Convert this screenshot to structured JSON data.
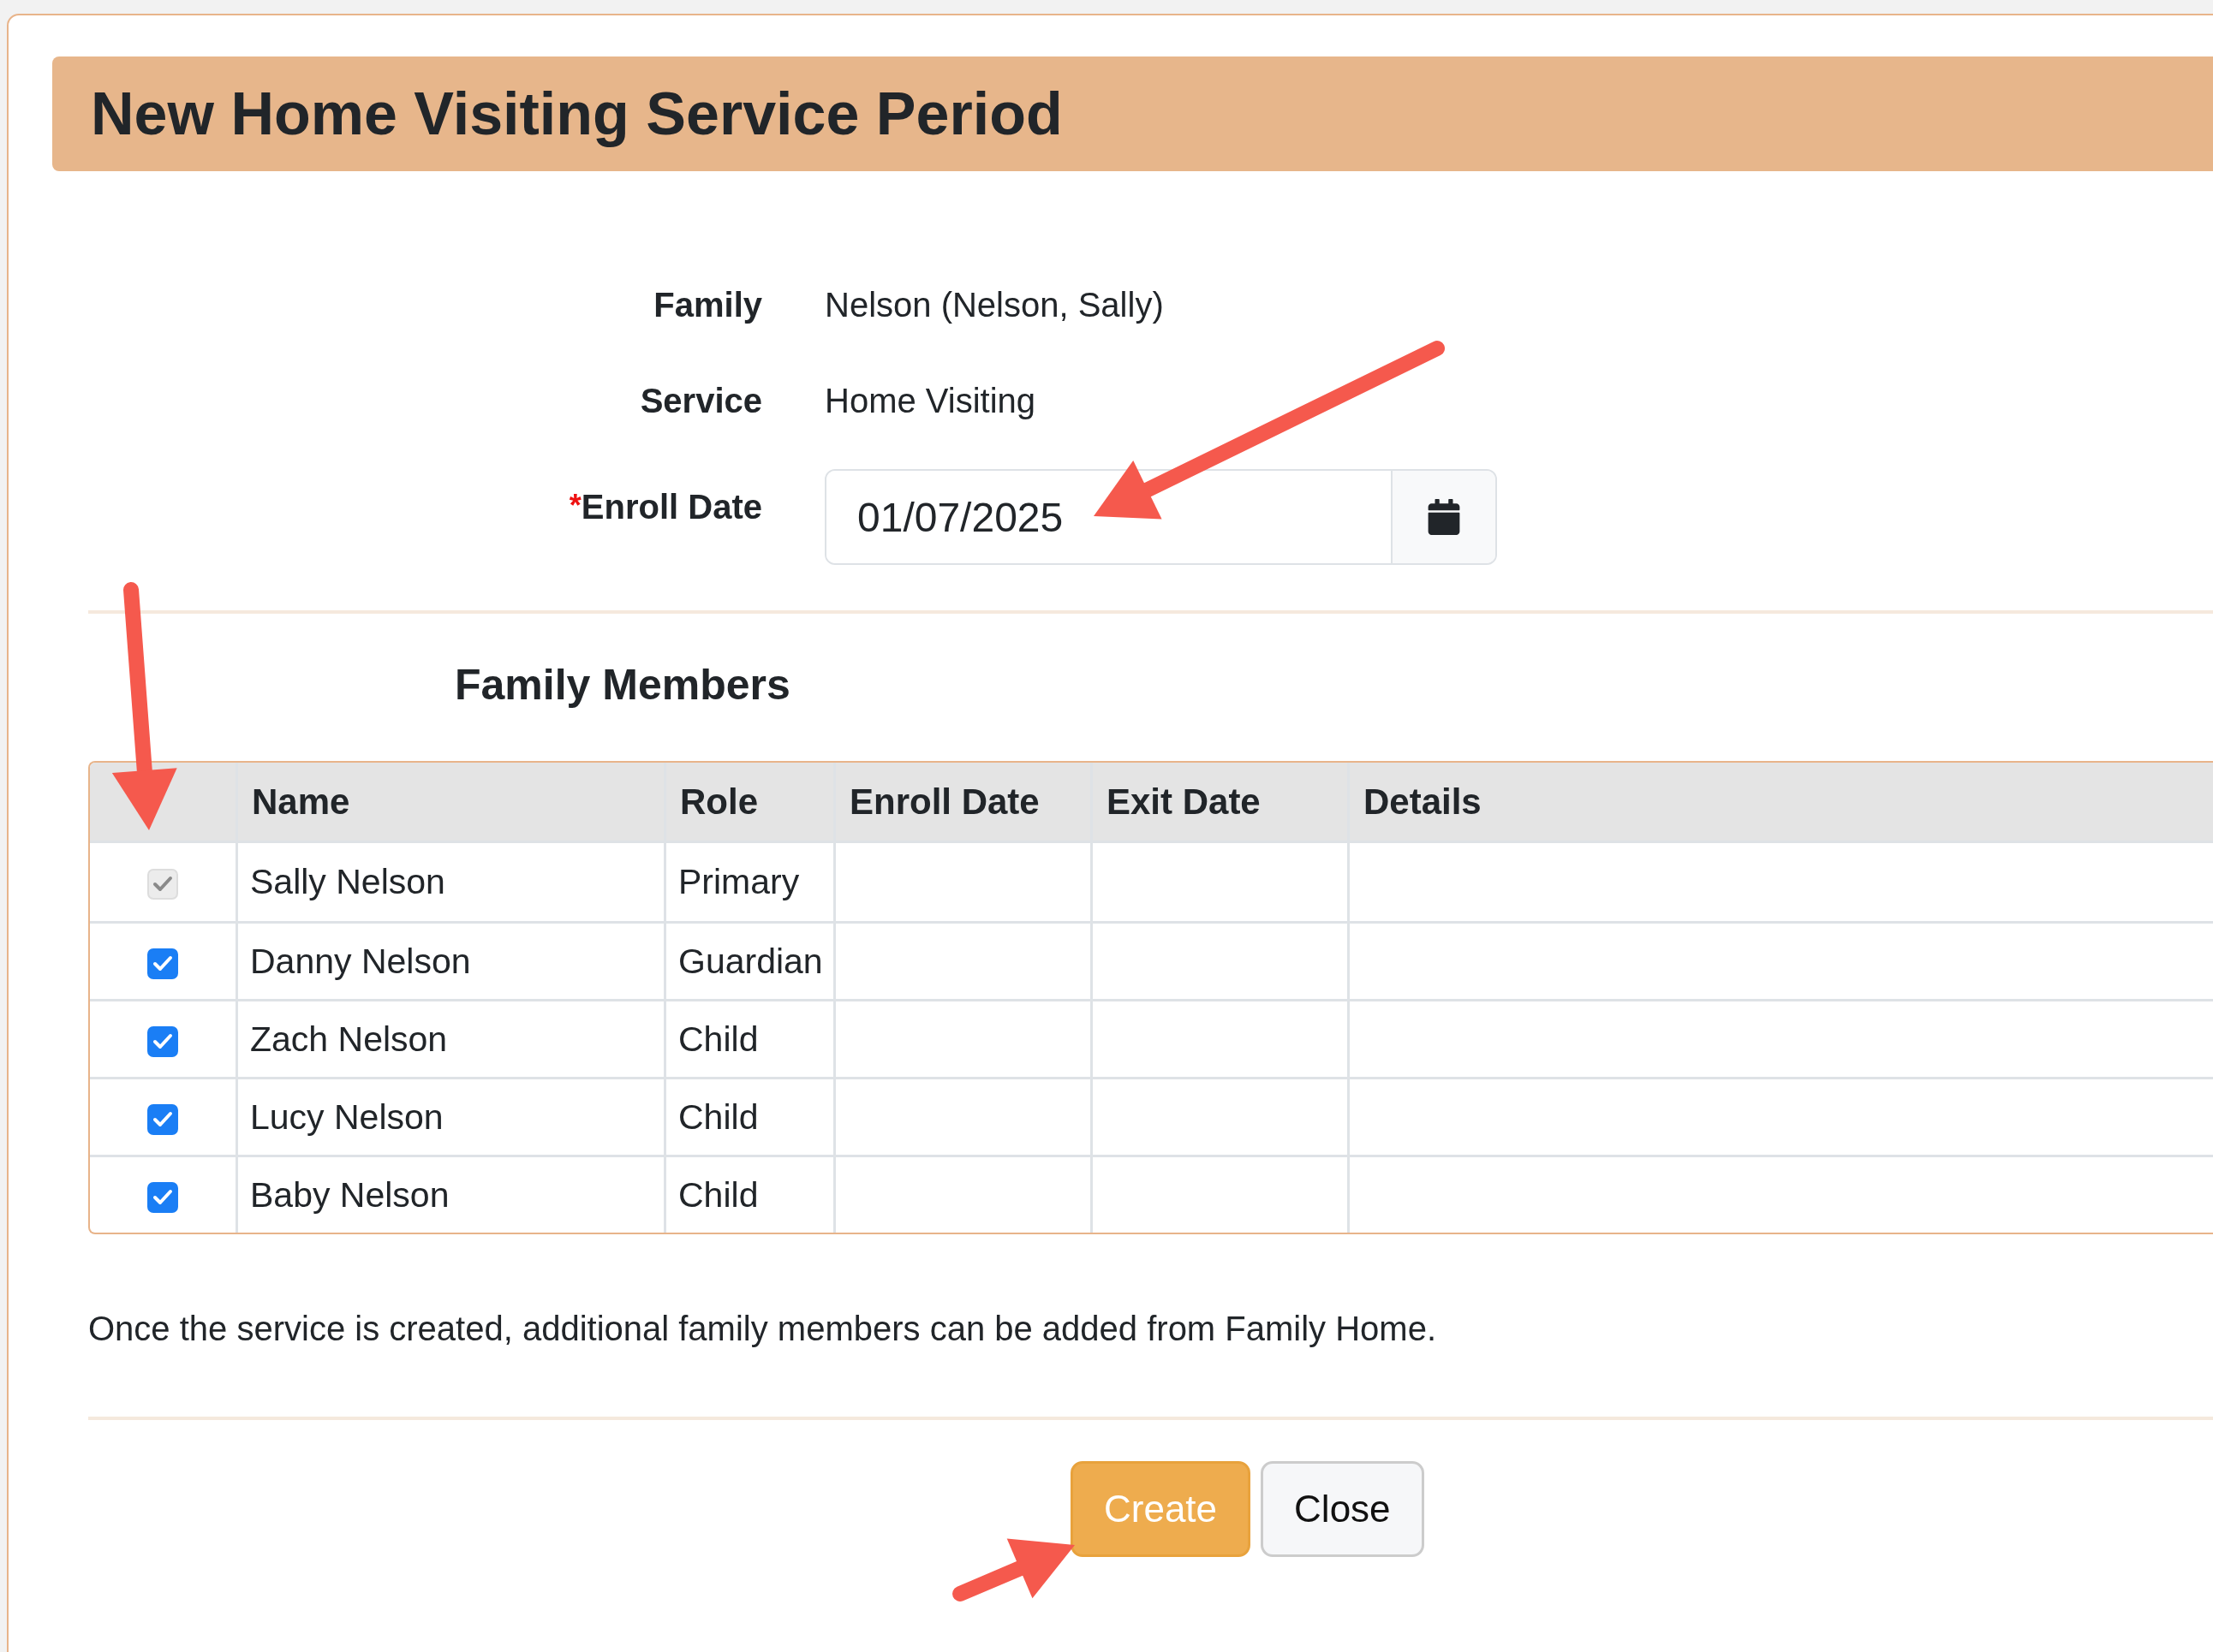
{
  "title": "New Home Visiting Service Period",
  "fields": [
    {
      "kind": "text",
      "label": "Family",
      "required": false,
      "value": "Nelson (Nelson, Sally)"
    },
    {
      "kind": "text",
      "label": "Service",
      "required": false,
      "value": "Home Visiting"
    },
    {
      "kind": "date",
      "label": "Enroll Date",
      "required": true,
      "value": "01/07/2025"
    }
  ],
  "required_mark": "*",
  "members_heading": "Family Members",
  "table": {
    "columns": [
      "Name",
      "Role",
      "Enroll Date",
      "Exit Date",
      "Details"
    ],
    "rows": [
      {
        "checked": true,
        "disabled": true,
        "name": "Sally Nelson",
        "role": "Primary"
      },
      {
        "checked": true,
        "disabled": false,
        "name": "Danny Nelson",
        "role": "Guardian"
      },
      {
        "checked": true,
        "disabled": false,
        "name": "Zach Nelson",
        "role": "Child"
      },
      {
        "checked": true,
        "disabled": false,
        "name": "Lucy Nelson",
        "role": "Child"
      },
      {
        "checked": true,
        "disabled": false,
        "name": "Baby Nelson",
        "role": "Child"
      }
    ]
  },
  "note": "Once the service is created, additional family members can be added from Family Home.",
  "buttons": [
    {
      "kind": "primary",
      "label": "Create"
    },
    {
      "kind": "secondary",
      "label": "Close"
    }
  ]
}
